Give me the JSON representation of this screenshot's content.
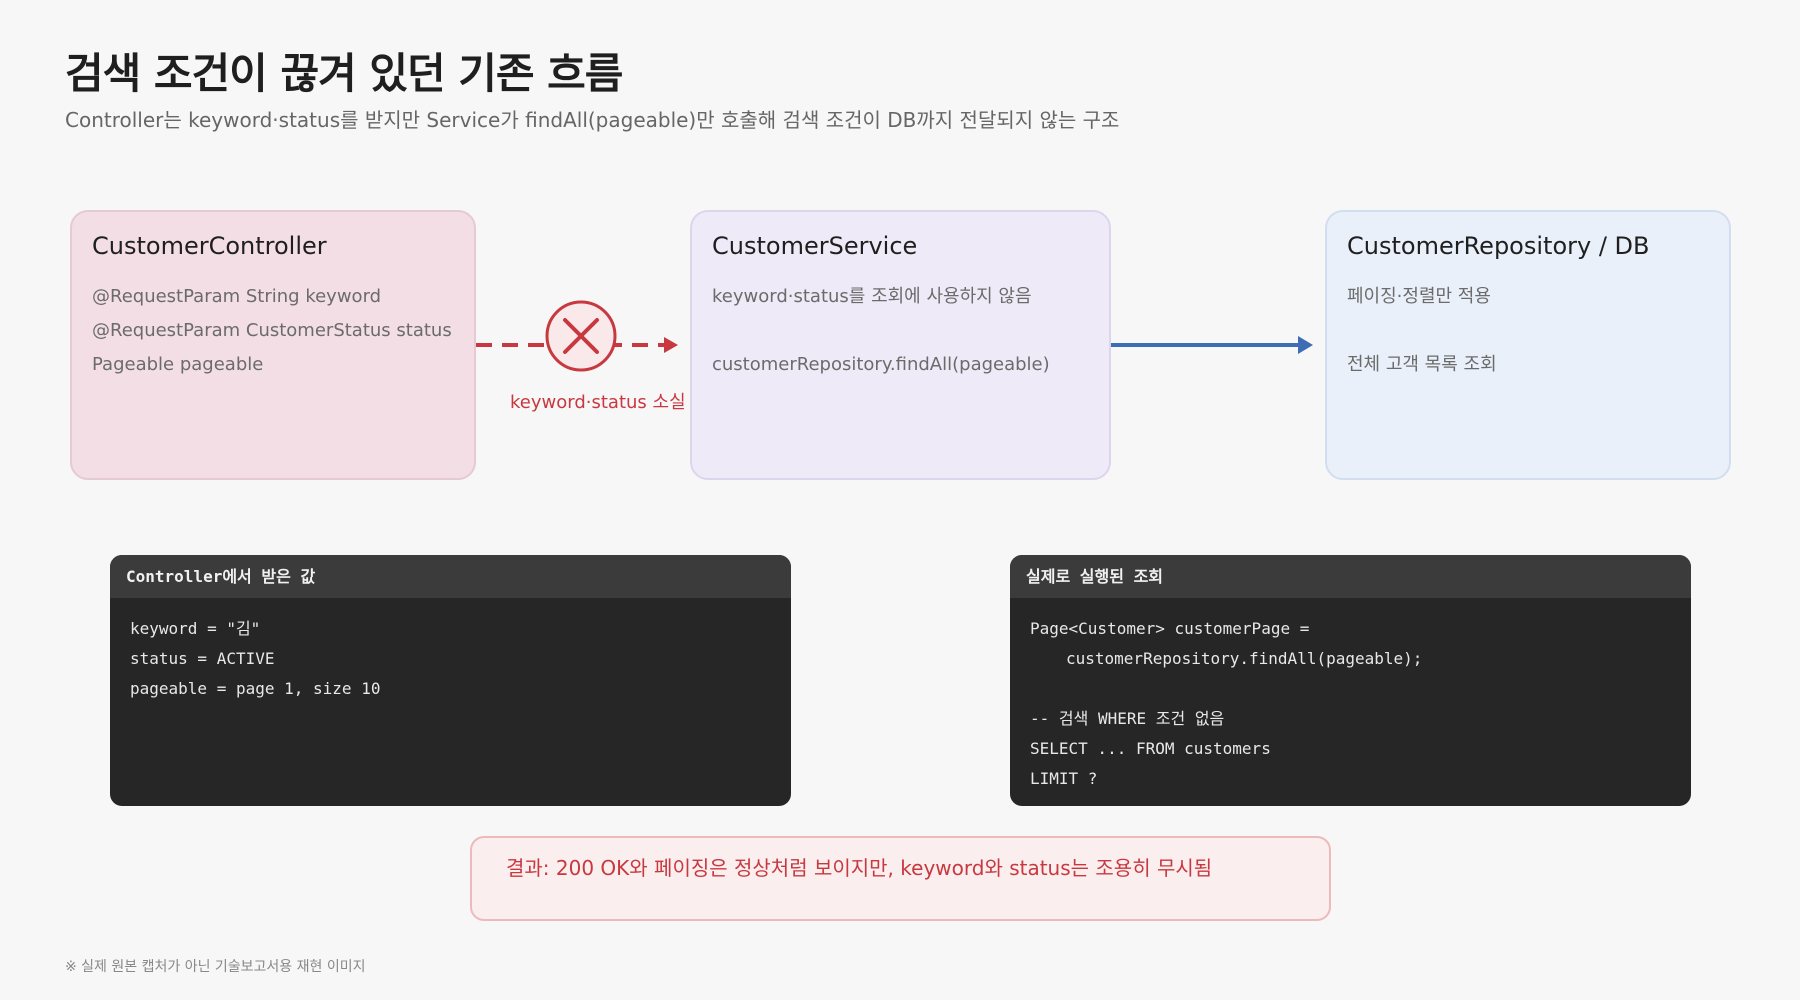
{
  "title": "검색 조건이 끊겨 있던 기존 흐름",
  "subtitle": "Controller는 keyword·status를 받지만 Service가 findAll(pageable)만 호출해 검색 조건이 DB까지 전달되지 않는 구조",
  "controller": {
    "title": "CustomerController",
    "lines": [
      "@RequestParam String keyword",
      "@RequestParam CustomerStatus status",
      "Pageable pageable"
    ]
  },
  "service": {
    "title": "CustomerService",
    "lines": [
      "keyword·status를 조회에 사용하지 않음",
      "customerRepository.findAll(pageable)"
    ]
  },
  "repository": {
    "title": "CustomerRepository / DB",
    "lines": [
      "페이징·정렬만 적용",
      "전체 고객 목록 조회"
    ]
  },
  "lost_label": "keyword·status 소실",
  "colors": {
    "lost": "#c8383f",
    "flow": "#3f6db5",
    "controller_bg": "#f3dee6",
    "service_bg": "#efeaf7",
    "repository_bg": "#e9f0fa",
    "code_bg": "#262626"
  },
  "code_left": {
    "header": "Controller에서 받은 값",
    "lines": [
      "keyword = \"김\"",
      "status = ACTIVE",
      "pageable = page 1, size 10"
    ]
  },
  "code_right": {
    "header": "실제로 실행된 조회",
    "lines": [
      "Page<Customer> customerPage =",
      "customerRepository.findAll(pageable);",
      "",
      "-- 검색 WHERE 조건 없음",
      "SELECT ... FROM customers",
      "LIMIT ?"
    ]
  },
  "result": "결과: 200 OK와 페이징은 정상처럼 보이지만, keyword와 status는 조용히 무시됨",
  "footnote": "※ 실제 원본 캡처가 아닌 기술보고서용 재현 이미지"
}
